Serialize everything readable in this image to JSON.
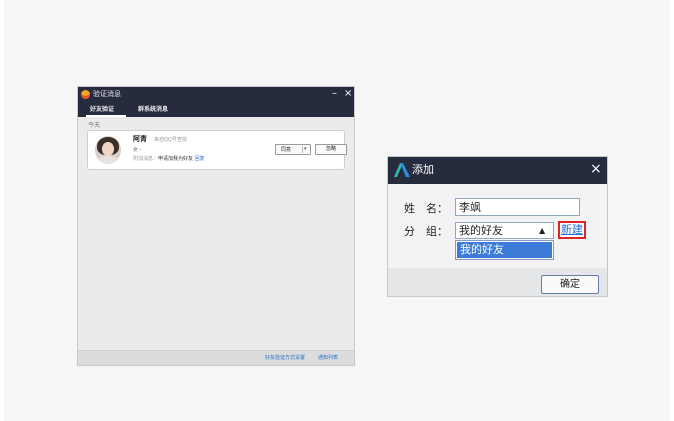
{
  "verify_window": {
    "title": "验证消息",
    "minimize_glyph": "–",
    "close_glyph": "×",
    "tabs": [
      {
        "label": "好友验证"
      },
      {
        "label": "群系统消息"
      }
    ],
    "date_label": "今天",
    "request": {
      "name": "阿青",
      "source": "来自QQ号查找",
      "gender_age": "女 -",
      "message_prefix": "附加消息：",
      "message_body": "申请加我为好友",
      "reply_link": "回复",
      "agree_label": "同意",
      "agree_dropdown_glyph": "▾",
      "ignore_label": "忽略"
    },
    "footer_links": [
      "好友验证方式设置",
      "通知列表"
    ]
  },
  "add_dialog": {
    "title": "添加",
    "close_glyph": "×",
    "name_label": "姓　名：",
    "name_value": "李飒",
    "group_label": "分　组：",
    "group_value": "我的好友",
    "group_dropdown_glyph": "▲",
    "new_group_link": "新建",
    "dropdown_options": [
      "我的好友"
    ],
    "ok_button": "确定"
  },
  "colors": {
    "titlebar": "#262c3d",
    "link_blue": "#1f6fd1",
    "highlight_red": "#e02424",
    "selection_blue": "#3d7bd8"
  }
}
